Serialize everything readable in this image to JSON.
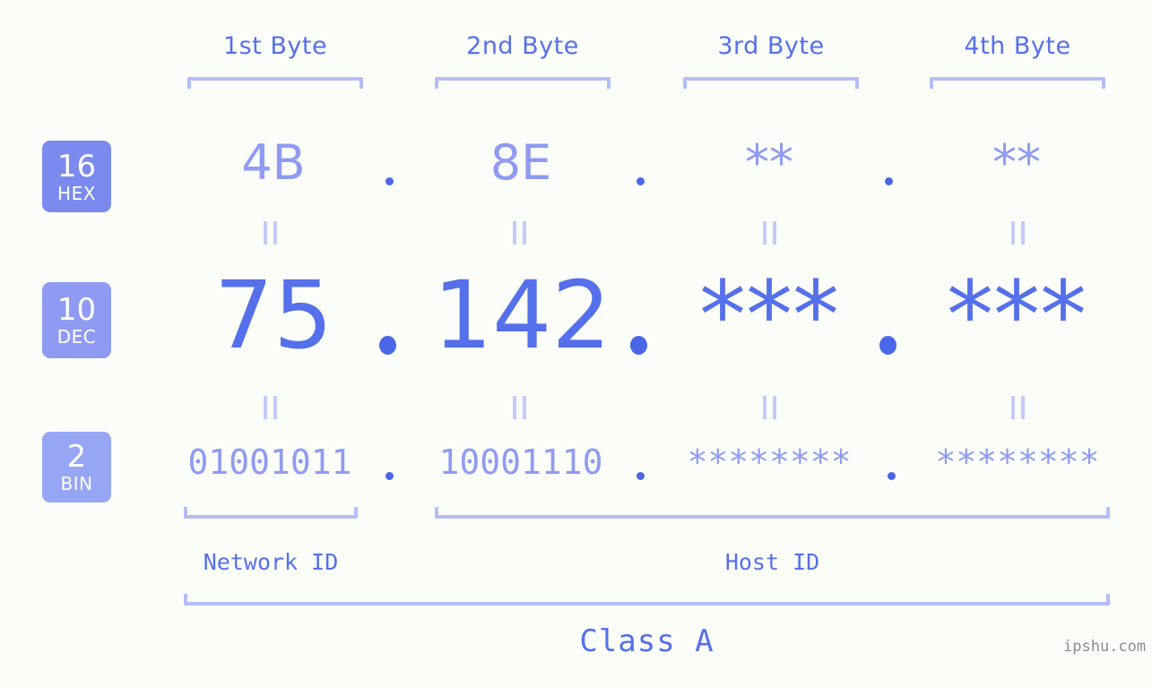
{
  "page": {
    "background_color": "#fbfdf8",
    "accent_color": "#5570ea",
    "light_accent_color": "#8f9bf2",
    "bracket_color": "#b4bdf7",
    "watermark": "ipshu.com"
  },
  "byte_headers": [
    {
      "label": "1st Byte"
    },
    {
      "label": "2nd Byte"
    },
    {
      "label": "3rd Byte"
    },
    {
      "label": "4th Byte"
    }
  ],
  "bases": [
    {
      "num": "16",
      "name": "HEX",
      "badge_color": "#7b8aee"
    },
    {
      "num": "10",
      "name": "DEC",
      "badge_color": "#8f9bf2"
    },
    {
      "num": "2",
      "name": "BIN",
      "badge_color": "#97a5f5"
    }
  ],
  "rows": {
    "hex": {
      "values": [
        "4B",
        "8E",
        "**",
        "**"
      ]
    },
    "dec": {
      "values": [
        "75",
        "142",
        "***",
        "***"
      ]
    },
    "bin": {
      "values": [
        "01001011",
        "10001110",
        "********",
        "********"
      ]
    }
  },
  "separators": {
    "dot": "."
  },
  "equals_marks": {
    "glyph": "||",
    "count": 8
  },
  "segments": [
    {
      "label": "Network ID"
    },
    {
      "label": "Host ID"
    }
  ],
  "class": {
    "label": "Class A"
  }
}
